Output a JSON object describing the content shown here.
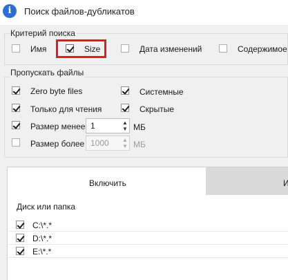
{
  "window": {
    "title": "Поиск файлов-дубликатов",
    "icon": "info-icon"
  },
  "criteria": {
    "group_label": "Критерий поиска",
    "items": [
      {
        "label": "Имя",
        "checked": false
      },
      {
        "label": "Size",
        "checked": true
      },
      {
        "label": "Дата изменений",
        "checked": false
      },
      {
        "label": "Содержимое",
        "checked": false
      }
    ]
  },
  "skip": {
    "group_label": "Пропускать файлы",
    "items": [
      {
        "label": "Zero byte files",
        "checked": true
      },
      {
        "label": "Системные",
        "checked": true
      },
      {
        "label": "Только для чтения",
        "checked": true
      },
      {
        "label": "Скрытые",
        "checked": true
      }
    ],
    "size_less": {
      "label": "Размер менее",
      "checked": true,
      "value": "1",
      "unit": "МБ"
    },
    "size_more": {
      "label": "Размер более",
      "checked": false,
      "value": "1000",
      "unit": "МБ"
    }
  },
  "tabs": [
    {
      "label": "Включить",
      "active": true
    },
    {
      "label": "И",
      "active": false
    }
  ],
  "list": {
    "header": "Диск или папка",
    "rows": [
      {
        "path": "C:\\*.*",
        "checked": true
      },
      {
        "path": "D:\\*.*",
        "checked": true
      },
      {
        "path": "E:\\*.*",
        "checked": true
      }
    ]
  },
  "colors": {
    "highlight": "#e01b24",
    "accent": "#2b6fd6"
  }
}
